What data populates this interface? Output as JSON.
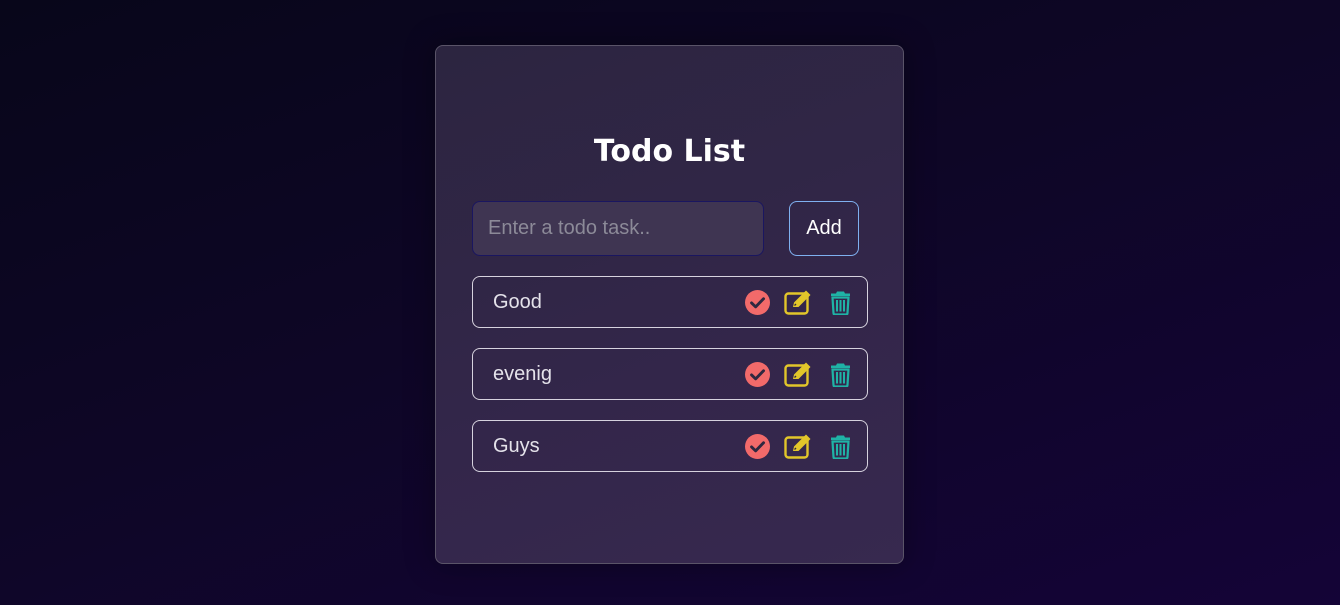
{
  "app": {
    "title": "Todo List"
  },
  "input": {
    "placeholder": "Enter a todo task..",
    "value": ""
  },
  "add_button": {
    "label": "Add"
  },
  "todos": [
    {
      "text": "Good"
    },
    {
      "text": "evenig"
    },
    {
      "text": "Guys"
    }
  ],
  "icons": {
    "complete": "check-circle-icon",
    "edit": "pen-to-square-icon",
    "delete": "trash-icon"
  },
  "colors": {
    "complete": "#f26a6a",
    "edit": "#e2c62a",
    "delete": "#1fb3a6",
    "add_border": "#7fb0f0"
  }
}
